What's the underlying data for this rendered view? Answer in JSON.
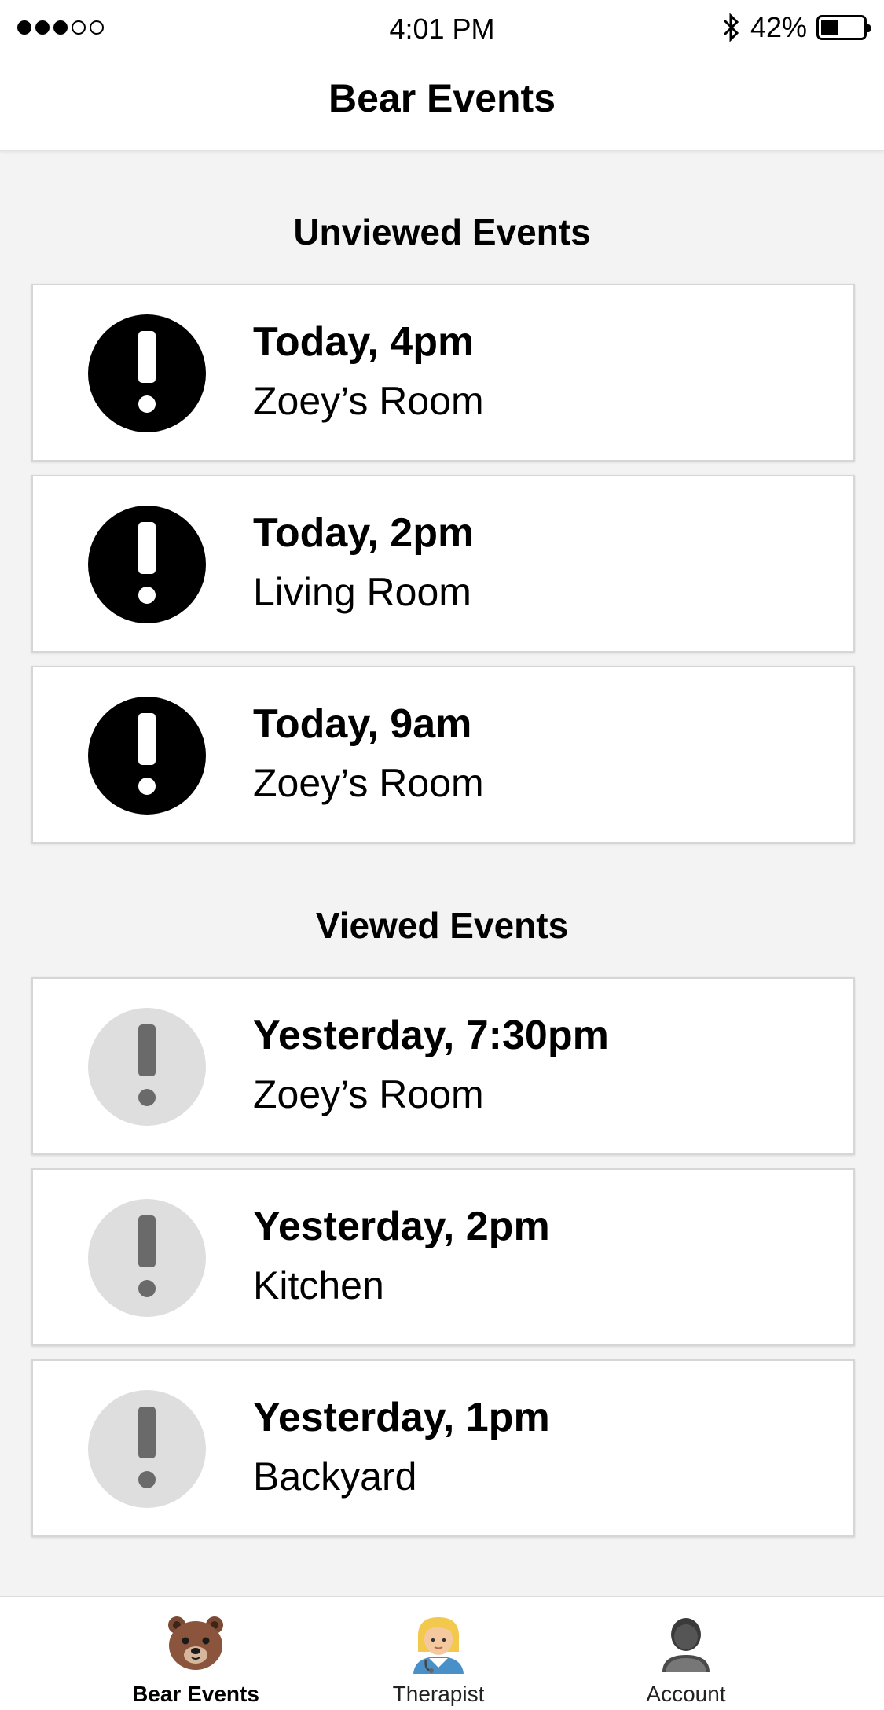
{
  "status_bar": {
    "time": "4:01 PM",
    "battery_percent": "42%",
    "battery_level": 0.42,
    "signal_strength": 3,
    "signal_total": 5
  },
  "nav": {
    "title": "Bear Events"
  },
  "sections": {
    "unviewed": {
      "title": "Unviewed Events",
      "events": [
        {
          "when": "Today, 4pm",
          "where": "Zoey’s Room"
        },
        {
          "when": "Today, 2pm",
          "where": "Living Room"
        },
        {
          "when": "Today, 9am",
          "where": "Zoey’s Room"
        }
      ]
    },
    "viewed": {
      "title": "Viewed Events",
      "events": [
        {
          "when": "Yesterday, 7:30pm",
          "where": "Zoey’s Room"
        },
        {
          "when": "Yesterday, 2pm",
          "where": "Kitchen"
        },
        {
          "when": "Yesterday, 1pm",
          "where": "Backyard"
        }
      ]
    }
  },
  "tab_bar": {
    "active": "bear-events",
    "tabs": [
      {
        "id": "bear-events",
        "label": "Bear Events",
        "icon": "bear-face-icon"
      },
      {
        "id": "therapist",
        "label": "Therapist",
        "icon": "health-worker-icon"
      },
      {
        "id": "account",
        "label": "Account",
        "icon": "person-silhouette-icon"
      }
    ]
  },
  "colors": {
    "unviewed_badge": "#000000",
    "viewed_badge": "#dedede",
    "viewed_mark": "#6a6a6a",
    "background": "#f3f3f3"
  }
}
